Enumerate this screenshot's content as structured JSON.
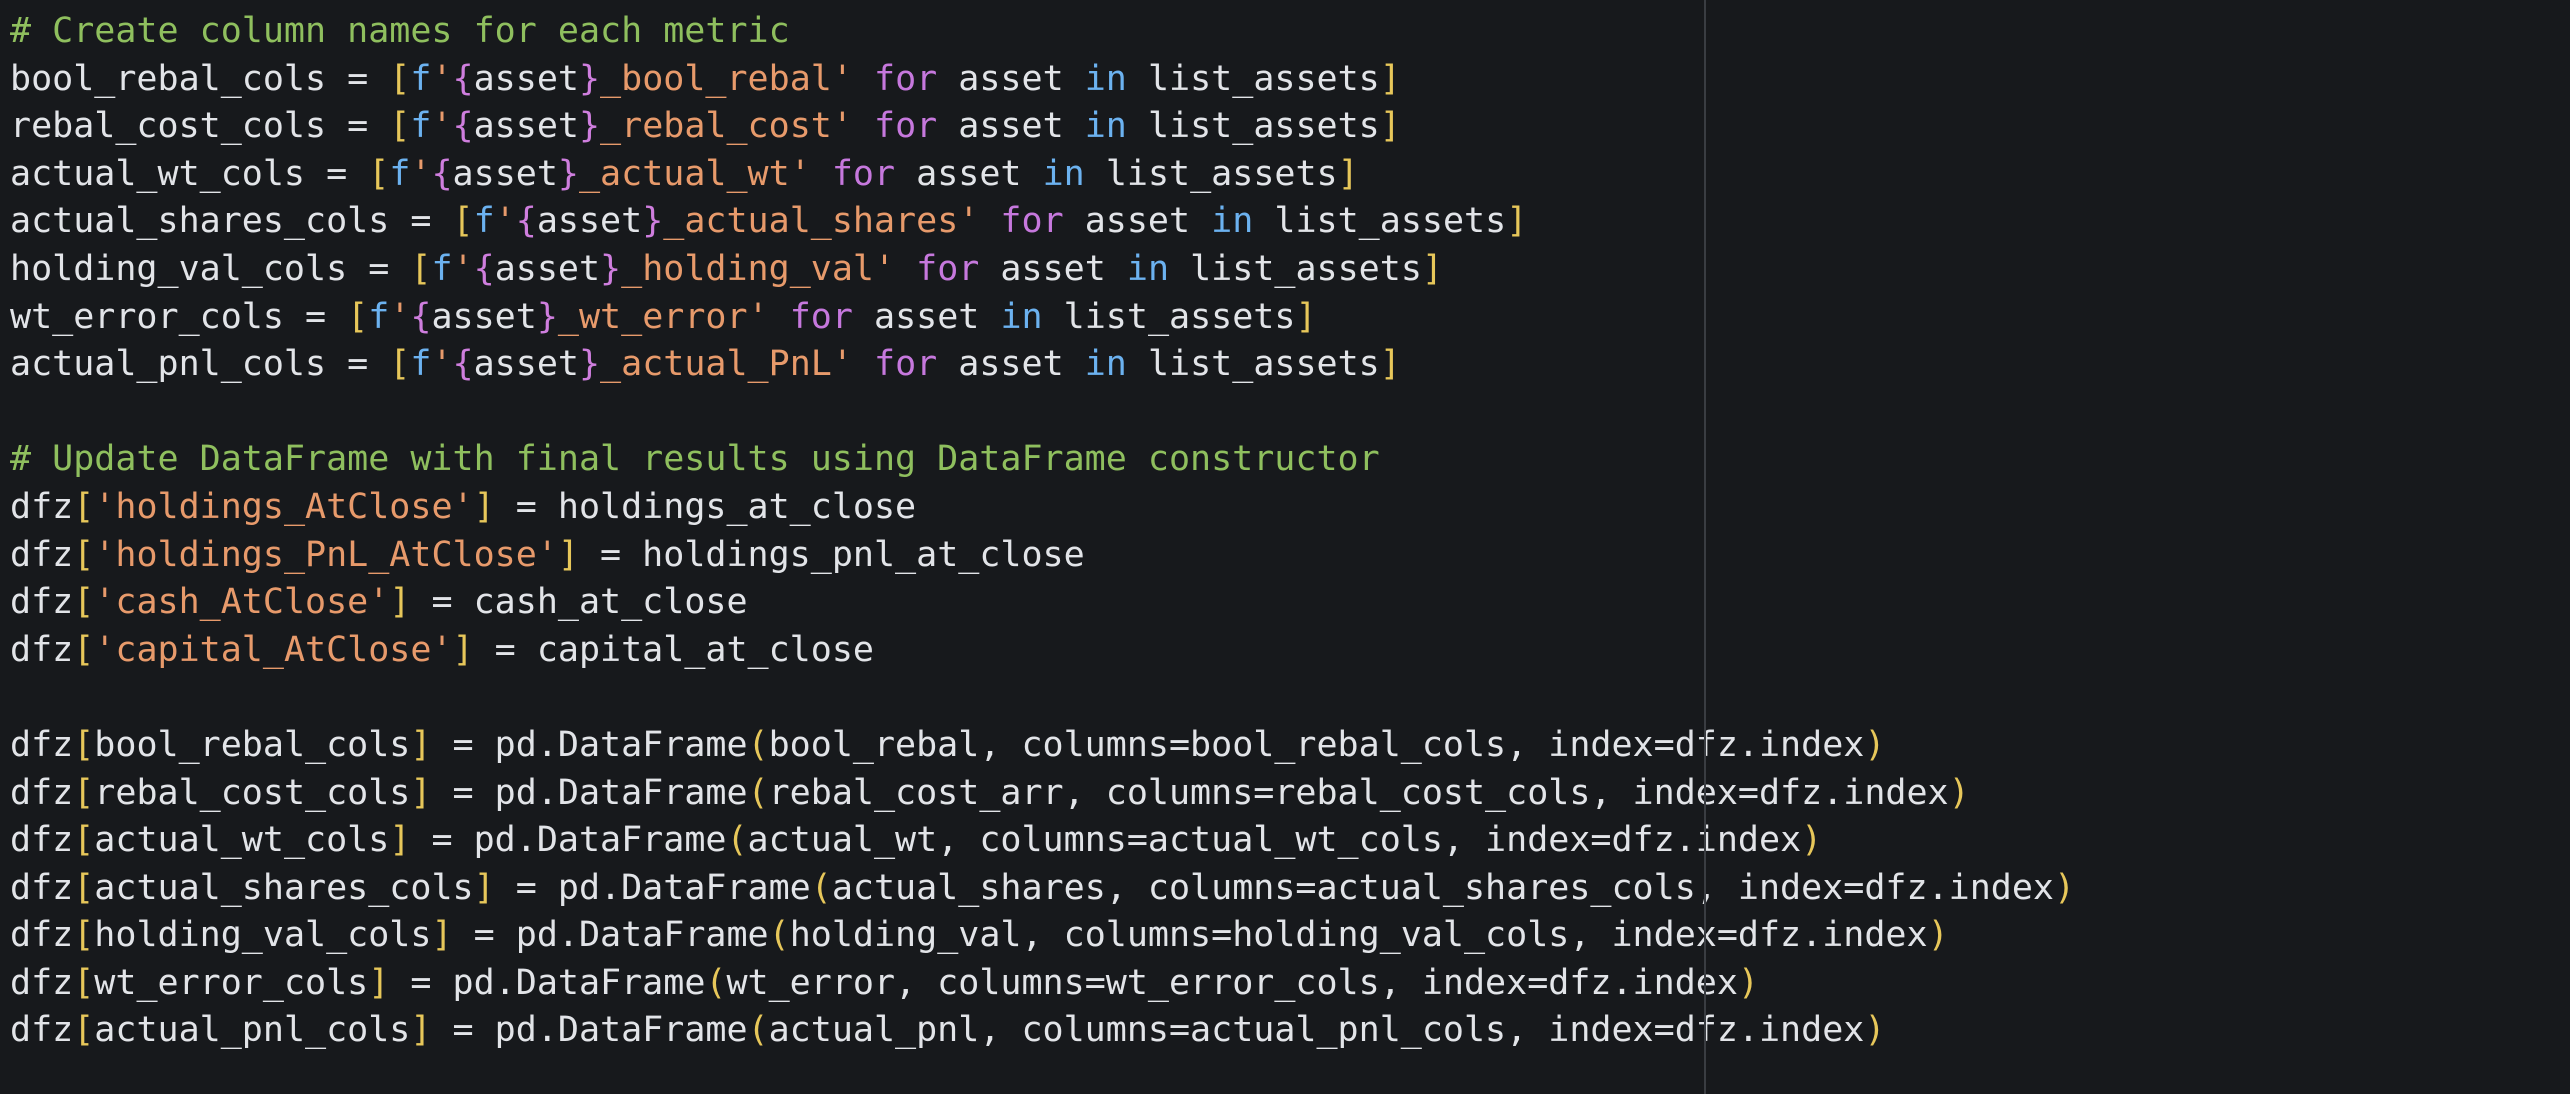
{
  "colors": {
    "background": "#17191c",
    "plain": "#e2e4e8",
    "comment": "#8fbf5e",
    "string": "#e79a6b",
    "fstring_interpolation": "#cf7ede",
    "keyword": "#c678dd",
    "keyword_in": "#6cb2f0",
    "bracket": "#e7c75a",
    "ruler": "#3a3d42"
  },
  "lines": [
    [
      {
        "t": "# Create column names for each metric",
        "k": "comment"
      }
    ],
    [
      {
        "t": "bool_rebal_cols = ",
        "k": "plain"
      },
      {
        "t": "[",
        "k": "bracket"
      },
      {
        "t": "f",
        "k": "fprefix"
      },
      {
        "t": "'",
        "k": "str"
      },
      {
        "t": "{",
        "k": "interp"
      },
      {
        "t": "asset",
        "k": "plain"
      },
      {
        "t": "}",
        "k": "interp"
      },
      {
        "t": "_bool_rebal'",
        "k": "str"
      },
      {
        "t": " ",
        "k": "plain"
      },
      {
        "t": "for",
        "k": "kw"
      },
      {
        "t": " asset ",
        "k": "plain"
      },
      {
        "t": "in",
        "k": "in"
      },
      {
        "t": " list_assets",
        "k": "plain"
      },
      {
        "t": "]",
        "k": "bracket"
      }
    ],
    [
      {
        "t": "rebal_cost_cols = ",
        "k": "plain"
      },
      {
        "t": "[",
        "k": "bracket"
      },
      {
        "t": "f",
        "k": "fprefix"
      },
      {
        "t": "'",
        "k": "str"
      },
      {
        "t": "{",
        "k": "interp"
      },
      {
        "t": "asset",
        "k": "plain"
      },
      {
        "t": "}",
        "k": "interp"
      },
      {
        "t": "_rebal_cost'",
        "k": "str"
      },
      {
        "t": " ",
        "k": "plain"
      },
      {
        "t": "for",
        "k": "kw"
      },
      {
        "t": " asset ",
        "k": "plain"
      },
      {
        "t": "in",
        "k": "in"
      },
      {
        "t": " list_assets",
        "k": "plain"
      },
      {
        "t": "]",
        "k": "bracket"
      }
    ],
    [
      {
        "t": "actual_wt_cols = ",
        "k": "plain"
      },
      {
        "t": "[",
        "k": "bracket"
      },
      {
        "t": "f",
        "k": "fprefix"
      },
      {
        "t": "'",
        "k": "str"
      },
      {
        "t": "{",
        "k": "interp"
      },
      {
        "t": "asset",
        "k": "plain"
      },
      {
        "t": "}",
        "k": "interp"
      },
      {
        "t": "_actual_wt'",
        "k": "str"
      },
      {
        "t": " ",
        "k": "plain"
      },
      {
        "t": "for",
        "k": "kw"
      },
      {
        "t": " asset ",
        "k": "plain"
      },
      {
        "t": "in",
        "k": "in"
      },
      {
        "t": " list_assets",
        "k": "plain"
      },
      {
        "t": "]",
        "k": "bracket"
      }
    ],
    [
      {
        "t": "actual_shares_cols = ",
        "k": "plain"
      },
      {
        "t": "[",
        "k": "bracket"
      },
      {
        "t": "f",
        "k": "fprefix"
      },
      {
        "t": "'",
        "k": "str"
      },
      {
        "t": "{",
        "k": "interp"
      },
      {
        "t": "asset",
        "k": "plain"
      },
      {
        "t": "}",
        "k": "interp"
      },
      {
        "t": "_actual_shares'",
        "k": "str"
      },
      {
        "t": " ",
        "k": "plain"
      },
      {
        "t": "for",
        "k": "kw"
      },
      {
        "t": " asset ",
        "k": "plain"
      },
      {
        "t": "in",
        "k": "in"
      },
      {
        "t": " list_assets",
        "k": "plain"
      },
      {
        "t": "]",
        "k": "bracket"
      }
    ],
    [
      {
        "t": "holding_val_cols = ",
        "k": "plain"
      },
      {
        "t": "[",
        "k": "bracket"
      },
      {
        "t": "f",
        "k": "fprefix"
      },
      {
        "t": "'",
        "k": "str"
      },
      {
        "t": "{",
        "k": "interp"
      },
      {
        "t": "asset",
        "k": "plain"
      },
      {
        "t": "}",
        "k": "interp"
      },
      {
        "t": "_holding_val'",
        "k": "str"
      },
      {
        "t": " ",
        "k": "plain"
      },
      {
        "t": "for",
        "k": "kw"
      },
      {
        "t": " asset ",
        "k": "plain"
      },
      {
        "t": "in",
        "k": "in"
      },
      {
        "t": " list_assets",
        "k": "plain"
      },
      {
        "t": "]",
        "k": "bracket"
      }
    ],
    [
      {
        "t": "wt_error_cols = ",
        "k": "plain"
      },
      {
        "t": "[",
        "k": "bracket"
      },
      {
        "t": "f",
        "k": "fprefix"
      },
      {
        "t": "'",
        "k": "str"
      },
      {
        "t": "{",
        "k": "interp"
      },
      {
        "t": "asset",
        "k": "plain"
      },
      {
        "t": "}",
        "k": "interp"
      },
      {
        "t": "_wt_error'",
        "k": "str"
      },
      {
        "t": " ",
        "k": "plain"
      },
      {
        "t": "for",
        "k": "kw"
      },
      {
        "t": " asset ",
        "k": "plain"
      },
      {
        "t": "in",
        "k": "in"
      },
      {
        "t": " list_assets",
        "k": "plain"
      },
      {
        "t": "]",
        "k": "bracket"
      }
    ],
    [
      {
        "t": "actual_pnl_cols = ",
        "k": "plain"
      },
      {
        "t": "[",
        "k": "bracket"
      },
      {
        "t": "f",
        "k": "fprefix"
      },
      {
        "t": "'",
        "k": "str"
      },
      {
        "t": "{",
        "k": "interp"
      },
      {
        "t": "asset",
        "k": "plain"
      },
      {
        "t": "}",
        "k": "interp"
      },
      {
        "t": "_actual_PnL'",
        "k": "str"
      },
      {
        "t": " ",
        "k": "plain"
      },
      {
        "t": "for",
        "k": "kw"
      },
      {
        "t": " asset ",
        "k": "plain"
      },
      {
        "t": "in",
        "k": "in"
      },
      {
        "t": " list_assets",
        "k": "plain"
      },
      {
        "t": "]",
        "k": "bracket"
      }
    ],
    [],
    [
      {
        "t": "# Update DataFrame with final results using DataFrame constructor",
        "k": "comment"
      }
    ],
    [
      {
        "t": "dfz",
        "k": "plain"
      },
      {
        "t": "[",
        "k": "bracket"
      },
      {
        "t": "'holdings_AtClose'",
        "k": "str"
      },
      {
        "t": "]",
        "k": "bracket"
      },
      {
        "t": " = holdings_at_close",
        "k": "plain"
      }
    ],
    [
      {
        "t": "dfz",
        "k": "plain"
      },
      {
        "t": "[",
        "k": "bracket"
      },
      {
        "t": "'holdings_PnL_AtClose'",
        "k": "str"
      },
      {
        "t": "]",
        "k": "bracket"
      },
      {
        "t": " = holdings_pnl_at_close",
        "k": "plain"
      }
    ],
    [
      {
        "t": "dfz",
        "k": "plain"
      },
      {
        "t": "[",
        "k": "bracket"
      },
      {
        "t": "'cash_AtClose'",
        "k": "str"
      },
      {
        "t": "]",
        "k": "bracket"
      },
      {
        "t": " = cash_at_close",
        "k": "plain"
      }
    ],
    [
      {
        "t": "dfz",
        "k": "plain"
      },
      {
        "t": "[",
        "k": "bracket"
      },
      {
        "t": "'capital_AtClose'",
        "k": "str"
      },
      {
        "t": "]",
        "k": "bracket"
      },
      {
        "t": " = capital_at_close",
        "k": "plain"
      }
    ],
    [],
    [
      {
        "t": "dfz",
        "k": "plain"
      },
      {
        "t": "[",
        "k": "bracket"
      },
      {
        "t": "bool_rebal_cols",
        "k": "plain"
      },
      {
        "t": "]",
        "k": "bracket"
      },
      {
        "t": " = pd.DataFrame",
        "k": "plain"
      },
      {
        "t": "(",
        "k": "bracket"
      },
      {
        "t": "bool_rebal, columns=bool_rebal_cols, index=dfz.index",
        "k": "plain"
      },
      {
        "t": ")",
        "k": "bracket"
      }
    ],
    [
      {
        "t": "dfz",
        "k": "plain"
      },
      {
        "t": "[",
        "k": "bracket"
      },
      {
        "t": "rebal_cost_cols",
        "k": "plain"
      },
      {
        "t": "]",
        "k": "bracket"
      },
      {
        "t": " = pd.DataFrame",
        "k": "plain"
      },
      {
        "t": "(",
        "k": "bracket"
      },
      {
        "t": "rebal_cost_arr, columns=rebal_cost_cols, index=dfz.index",
        "k": "plain"
      },
      {
        "t": ")",
        "k": "bracket"
      }
    ],
    [
      {
        "t": "dfz",
        "k": "plain"
      },
      {
        "t": "[",
        "k": "bracket"
      },
      {
        "t": "actual_wt_cols",
        "k": "plain"
      },
      {
        "t": "]",
        "k": "bracket"
      },
      {
        "t": " = pd.DataFrame",
        "k": "plain"
      },
      {
        "t": "(",
        "k": "bracket"
      },
      {
        "t": "actual_wt, columns=actual_wt_cols, index=dfz.index",
        "k": "plain"
      },
      {
        "t": ")",
        "k": "bracket"
      }
    ],
    [
      {
        "t": "dfz",
        "k": "plain"
      },
      {
        "t": "[",
        "k": "bracket"
      },
      {
        "t": "actual_shares_cols",
        "k": "plain"
      },
      {
        "t": "]",
        "k": "bracket"
      },
      {
        "t": " = pd.DataFrame",
        "k": "plain"
      },
      {
        "t": "(",
        "k": "bracket"
      },
      {
        "t": "actual_shares, columns=actual_shares_cols, index=dfz.index",
        "k": "plain"
      },
      {
        "t": ")",
        "k": "bracket"
      }
    ],
    [
      {
        "t": "dfz",
        "k": "plain"
      },
      {
        "t": "[",
        "k": "bracket"
      },
      {
        "t": "holding_val_cols",
        "k": "plain"
      },
      {
        "t": "]",
        "k": "bracket"
      },
      {
        "t": " = pd.DataFrame",
        "k": "plain"
      },
      {
        "t": "(",
        "k": "bracket"
      },
      {
        "t": "holding_val, columns=holding_val_cols, index=dfz.index",
        "k": "plain"
      },
      {
        "t": ")",
        "k": "bracket"
      }
    ],
    [
      {
        "t": "dfz",
        "k": "plain"
      },
      {
        "t": "[",
        "k": "bracket"
      },
      {
        "t": "wt_error_cols",
        "k": "plain"
      },
      {
        "t": "]",
        "k": "bracket"
      },
      {
        "t": " = pd.DataFrame",
        "k": "plain"
      },
      {
        "t": "(",
        "k": "bracket"
      },
      {
        "t": "wt_error, columns=wt_error_cols, index=dfz.index",
        "k": "plain"
      },
      {
        "t": ")",
        "k": "bracket"
      }
    ],
    [
      {
        "t": "dfz",
        "k": "plain"
      },
      {
        "t": "[",
        "k": "bracket"
      },
      {
        "t": "actual_pnl_cols",
        "k": "plain"
      },
      {
        "t": "]",
        "k": "bracket"
      },
      {
        "t": " = pd.DataFrame",
        "k": "plain"
      },
      {
        "t": "(",
        "k": "bracket"
      },
      {
        "t": "actual_pnl, columns=actual_pnl_cols, index=dfz.index",
        "k": "plain"
      },
      {
        "t": ")",
        "k": "bracket"
      }
    ]
  ]
}
